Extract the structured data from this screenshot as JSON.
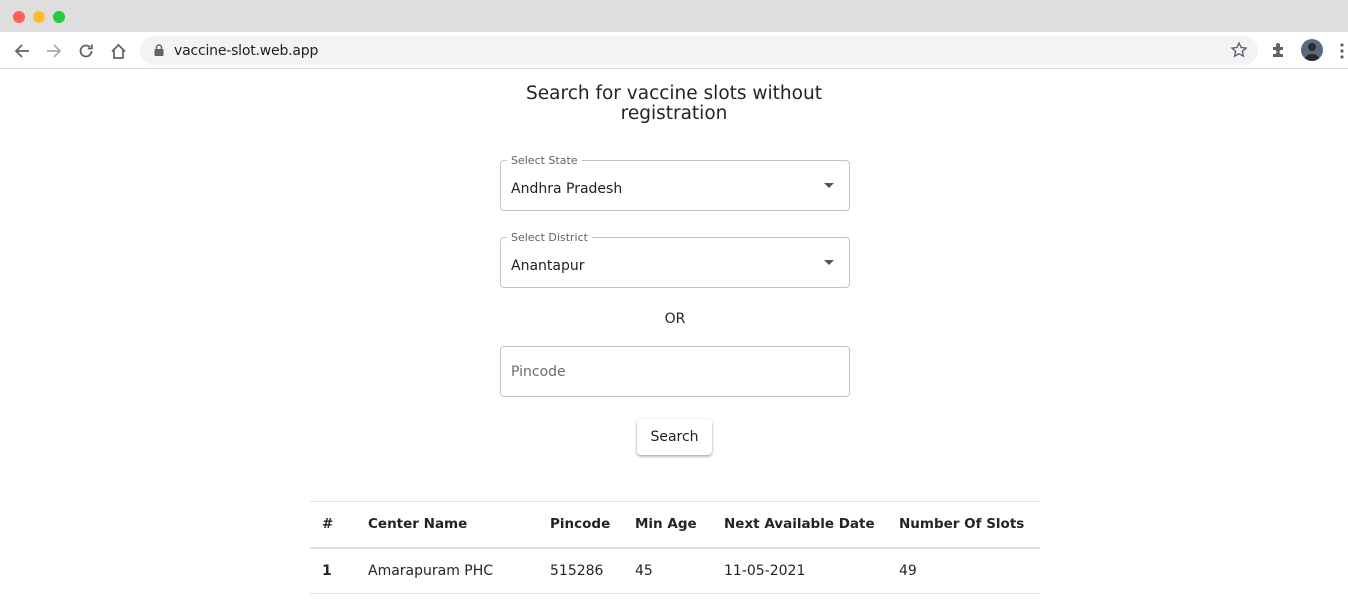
{
  "browser": {
    "url": "vaccine-slot.web.app"
  },
  "page": {
    "title": "Search for vaccine slots without registration"
  },
  "form": {
    "state_label": "Select State",
    "state_value": "Andhra Pradesh",
    "district_label": "Select District",
    "district_value": "Anantapur",
    "or_text": "OR",
    "pincode_placeholder": "Pincode",
    "search_label": "Search"
  },
  "table": {
    "headers": [
      "#",
      "Center Name",
      "Pincode",
      "Min Age",
      "Next Available Date",
      "Number Of Slots"
    ],
    "rows": [
      [
        "1",
        "Amarapuram PHC",
        "515286",
        "45",
        "11-05-2021",
        "49"
      ]
    ]
  }
}
